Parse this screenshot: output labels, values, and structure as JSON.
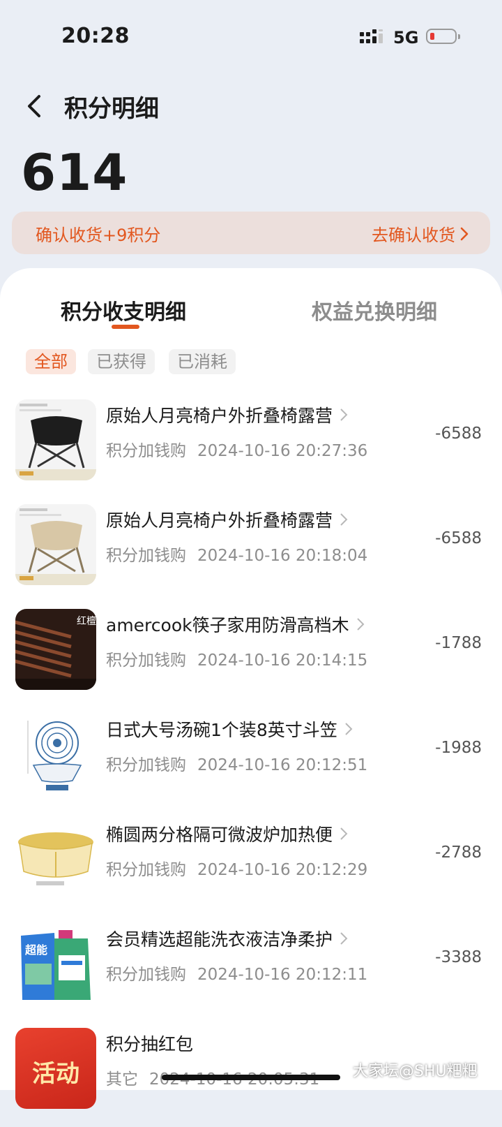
{
  "status_bar": {
    "time": "20:28",
    "network": "5G"
  },
  "header": {
    "title": "积分明细",
    "points": "614"
  },
  "banner": {
    "text": "确认收货+9积分",
    "action": "去确认收货"
  },
  "tabs": [
    {
      "label": "积分收支明细",
      "active": true
    },
    {
      "label": "权益兑换明细",
      "active": false
    }
  ],
  "filters": [
    {
      "label": "全部",
      "selected": true
    },
    {
      "label": "已获得",
      "selected": false
    },
    {
      "label": "已消耗",
      "selected": false
    }
  ],
  "records": [
    {
      "title": "原始人月亮椅户外折叠椅露营",
      "type": "积分加钱购",
      "time": "2024-10-16 20:27:36",
      "amount": "-6588"
    },
    {
      "title": "原始人月亮椅户外折叠椅露营",
      "type": "积分加钱购",
      "time": "2024-10-16 20:18:04",
      "amount": "-6588"
    },
    {
      "title": "amercook筷子家用防滑高档木",
      "type": "积分加钱购",
      "time": "2024-10-16 20:14:15",
      "amount": "-1788"
    },
    {
      "title": "日式大号汤碗1个装8英寸斗笠",
      "type": "积分加钱购",
      "time": "2024-10-16 20:12:51",
      "amount": "-1988"
    },
    {
      "title": "椭圆两分格隔可微波炉加热便",
      "type": "积分加钱购",
      "time": "2024-10-16 20:12:29",
      "amount": "-2788"
    },
    {
      "title": "会员精选超能洗衣液洁净柔护",
      "type": "积分加钱购",
      "time": "2024-10-16 20:12:11",
      "amount": "-3388"
    },
    {
      "title": "积分抽红包",
      "type": "其它",
      "time": "2024-10-16 20:05:31",
      "amount": ""
    }
  ],
  "thumb_labels": {
    "activity": "活动",
    "chopsticks": "红檀木筷",
    "detergent_brand": "超能"
  },
  "watermark": "大家坛@SHU粑粑",
  "colors": {
    "accent": "#e2571f",
    "banner_bg": "#ecdfdc",
    "page_bg": "#eaeef5"
  }
}
